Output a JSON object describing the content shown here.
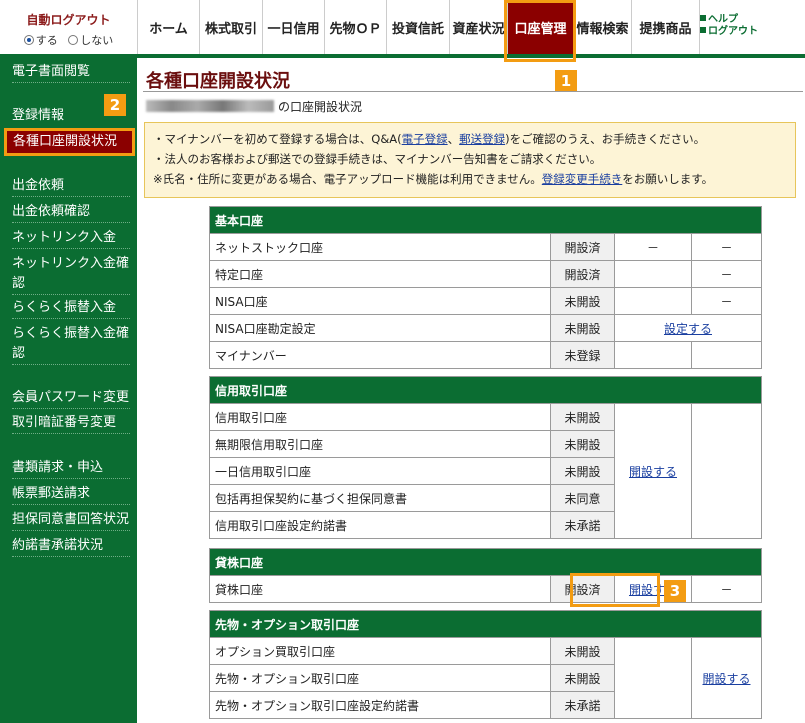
{
  "header": {
    "autologout_title": "自動ログアウト",
    "opt_on": "する",
    "opt_off": "しない",
    "nav": [
      "ホーム",
      "株式取引",
      "一日信用",
      "先物ＯＰ",
      "投資信託",
      "資産状況",
      "口座管理",
      "情報検索",
      "提携商品"
    ],
    "active_nav": "口座管理",
    "help": "ヘルプ",
    "logout": "ログアウト"
  },
  "sidebar": {
    "items": [
      "電子書面閲覧",
      "登録情報",
      "各種口座開設状況",
      "出金依頼",
      "出金依頼確認",
      "ネットリンク入金",
      "ネットリンク入金確認",
      "らくらく振替入金",
      "らくらく振替入金確認",
      "会員パスワード変更",
      "取引暗証番号変更",
      "書類請求・申込",
      "帳票郵送請求",
      "担保同意書回答状況",
      "約諾書承諾状況"
    ]
  },
  "markers": [
    "1",
    "2",
    "3"
  ],
  "main": {
    "title": "各種口座開設状況",
    "subtitle": "の口座開設状況",
    "notice": {
      "l1a": "・マイナンバーを初めて登録する場合は、Q&A(",
      "l1_link1": "電子登録",
      "l1b": "、",
      "l1_link2": "郵送登録",
      "l1c": ")をご確認のうえ、お手続きください。",
      "l2": "・法人のお客様および郵送での登録手続きは、マイナンバー告知書をご請求ください。",
      "l3a": "※氏名・住所に変更がある場合、電子アップロード機能は利用できません。",
      "l3_link": "登録変更手続き",
      "l3b": "をお願いします。"
    },
    "basic": {
      "header": "基本口座",
      "rows": [
        {
          "name": "ネットストック口座",
          "status": "開設済",
          "c1": "－",
          "c2": "－"
        },
        {
          "name": "特定口座",
          "status": "開設済",
          "c1": "",
          "c2": "－"
        },
        {
          "name": "NISA口座",
          "status": "未開設",
          "c1": "",
          "c2": "－"
        },
        {
          "name": "NISA口座勘定設定",
          "status": "未開設",
          "link": "設定する"
        },
        {
          "name": "マイナンバー",
          "status": "未登録",
          "c1": "",
          "c2": ""
        }
      ]
    },
    "margin": {
      "header": "信用取引口座",
      "link": "開設する",
      "rows": [
        {
          "name": "信用取引口座",
          "status": "未開設"
        },
        {
          "name": "無期限信用取引口座",
          "status": "未開設"
        },
        {
          "name": "一日信用取引口座",
          "status": "未開設"
        },
        {
          "name": "包括再担保契約に基づく担保同意書",
          "status": "未同意"
        },
        {
          "name": "信用取引口座設定約諾書",
          "status": "未承諾"
        }
      ]
    },
    "lending": {
      "header": "貸株口座",
      "rows": [
        {
          "name": "貸株口座",
          "status": "開設済",
          "link": "開設する",
          "c2": "－"
        }
      ]
    },
    "futures": {
      "header": "先物・オプション取引口座",
      "link": "開設する",
      "rows": [
        {
          "name": "オプション買取引口座",
          "status": "未開設"
        },
        {
          "name": "先物・オプション取引口座",
          "status": "未開設"
        },
        {
          "name": "先物・オプション取引口座設定約諾書",
          "status": "未承諾"
        }
      ]
    }
  }
}
